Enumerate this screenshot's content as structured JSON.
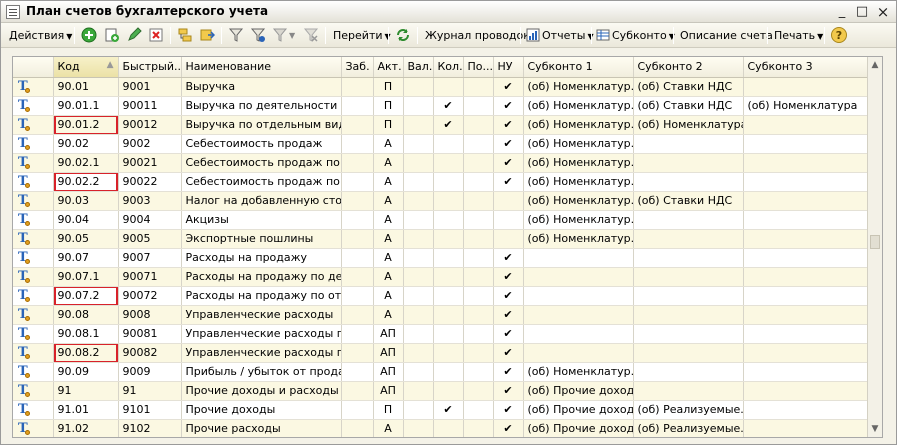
{
  "window": {
    "title": "План счетов бухгалтерского учета",
    "minimize": "_",
    "maximize": "□",
    "close": "×"
  },
  "toolbar": {
    "actions": "Действия",
    "goto": "Перейти",
    "journal": "Журнал проводок",
    "reports": "Отчеты",
    "subkonto": "Субконто",
    "description": "Описание счета",
    "print": "Печать",
    "help": "?"
  },
  "grid": {
    "columns": [
      "",
      "Код",
      "Быстрый...",
      "Наименование",
      "Заб.",
      "Акт.",
      "Вал.",
      "Кол.",
      "По...",
      "НУ",
      "Субконто 1",
      "Субконто 2",
      "Субконто 3"
    ],
    "check": "✔",
    "sort_indicator": "▲",
    "rows": [
      {
        "code": "90.01",
        "quick": "9001",
        "name": "Выручка",
        "zab": "",
        "akt": "П",
        "val": "",
        "kol": "",
        "po": "",
        "nu": "✔",
        "s1": "(об) Номенклатур...",
        "s2": "(об) Ставки НДС",
        "s3": "",
        "highlight": false
      },
      {
        "code": "90.01.1",
        "quick": "90011",
        "name": "Выручка по деятельности с ...",
        "zab": "",
        "akt": "П",
        "val": "",
        "kol": "✔",
        "po": "",
        "nu": "✔",
        "s1": "(об) Номенклатур...",
        "s2": "(об) Ставки НДС",
        "s3": "(об) Номенклатура",
        "highlight": false
      },
      {
        "code": "90.01.2",
        "quick": "90012",
        "name": "Выручка по отдельным вида...",
        "zab": "",
        "akt": "П",
        "val": "",
        "kol": "✔",
        "po": "",
        "nu": "✔",
        "s1": "(об) Номенклатур...",
        "s2": "(об) Номенклатура",
        "s3": "",
        "highlight": true
      },
      {
        "code": "90.02",
        "quick": "9002",
        "name": "Себестоимость продаж",
        "zab": "",
        "akt": "А",
        "val": "",
        "kol": "",
        "po": "",
        "nu": "✔",
        "s1": "(об) Номенклатур...",
        "s2": "",
        "s3": "",
        "highlight": false
      },
      {
        "code": "90.02.1",
        "quick": "90021",
        "name": "Себестоимость продаж по д...",
        "zab": "",
        "akt": "А",
        "val": "",
        "kol": "",
        "po": "",
        "nu": "✔",
        "s1": "(об) Номенклатур...",
        "s2": "",
        "s3": "",
        "highlight": false
      },
      {
        "code": "90.02.2",
        "quick": "90022",
        "name": "Себестоимость продаж по о...",
        "zab": "",
        "akt": "А",
        "val": "",
        "kol": "",
        "po": "",
        "nu": "✔",
        "s1": "(об) Номенклатур...",
        "s2": "",
        "s3": "",
        "highlight": true
      },
      {
        "code": "90.03",
        "quick": "9003",
        "name": "Налог на добавленную стои...",
        "zab": "",
        "akt": "А",
        "val": "",
        "kol": "",
        "po": "",
        "nu": "",
        "s1": "(об) Номенклатур...",
        "s2": "(об) Ставки НДС",
        "s3": "",
        "highlight": false
      },
      {
        "code": "90.04",
        "quick": "9004",
        "name": "Акцизы",
        "zab": "",
        "akt": "А",
        "val": "",
        "kol": "",
        "po": "",
        "nu": "",
        "s1": "(об) Номенклатур...",
        "s2": "",
        "s3": "",
        "highlight": false
      },
      {
        "code": "90.05",
        "quick": "9005",
        "name": "Экспортные пошлины",
        "zab": "",
        "akt": "А",
        "val": "",
        "kol": "",
        "po": "",
        "nu": "",
        "s1": "(об) Номенклатур...",
        "s2": "",
        "s3": "",
        "highlight": false
      },
      {
        "code": "90.07",
        "quick": "9007",
        "name": "Расходы на продажу",
        "zab": "",
        "akt": "А",
        "val": "",
        "kol": "",
        "po": "",
        "nu": "✔",
        "s1": "",
        "s2": "",
        "s3": "",
        "highlight": false
      },
      {
        "code": "90.07.1",
        "quick": "90071",
        "name": "Расходы на продажу по деят...",
        "zab": "",
        "akt": "А",
        "val": "",
        "kol": "",
        "po": "",
        "nu": "✔",
        "s1": "",
        "s2": "",
        "s3": "",
        "highlight": false
      },
      {
        "code": "90.07.2",
        "quick": "90072",
        "name": "Расходы на продажу по отде...",
        "zab": "",
        "akt": "А",
        "val": "",
        "kol": "",
        "po": "",
        "nu": "✔",
        "s1": "",
        "s2": "",
        "s3": "",
        "highlight": true
      },
      {
        "code": "90.08",
        "quick": "9008",
        "name": "Управленческие расходы",
        "zab": "",
        "akt": "А",
        "val": "",
        "kol": "",
        "po": "",
        "nu": "✔",
        "s1": "",
        "s2": "",
        "s3": "",
        "highlight": false
      },
      {
        "code": "90.08.1",
        "quick": "90081",
        "name": "Управленческие расходы по...",
        "zab": "",
        "akt": "АП",
        "val": "",
        "kol": "",
        "po": "",
        "nu": "✔",
        "s1": "",
        "s2": "",
        "s3": "",
        "highlight": false
      },
      {
        "code": "90.08.2",
        "quick": "90082",
        "name": "Управленческие расходы по...",
        "zab": "",
        "akt": "АП",
        "val": "",
        "kol": "",
        "po": "",
        "nu": "✔",
        "s1": "",
        "s2": "",
        "s3": "",
        "highlight": true
      },
      {
        "code": "90.09",
        "quick": "9009",
        "name": "Прибыль / убыток от продаж",
        "zab": "",
        "akt": "АП",
        "val": "",
        "kol": "",
        "po": "",
        "nu": "✔",
        "s1": "(об) Номенклатур...",
        "s2": "",
        "s3": "",
        "highlight": false
      },
      {
        "code": "91",
        "quick": "91",
        "name": "Прочие доходы и расходы",
        "zab": "",
        "akt": "АП",
        "val": "",
        "kol": "",
        "po": "",
        "nu": "✔",
        "s1": "(об) Прочие доход...",
        "s2": "",
        "s3": "",
        "highlight": false
      },
      {
        "code": "91.01",
        "quick": "9101",
        "name": "Прочие доходы",
        "zab": "",
        "akt": "П",
        "val": "",
        "kol": "✔",
        "po": "",
        "nu": "✔",
        "s1": "(об) Прочие доход...",
        "s2": "(об) Реализуемые...",
        "s3": "",
        "highlight": false
      },
      {
        "code": "91.02",
        "quick": "9102",
        "name": "Прочие расходы",
        "zab": "",
        "akt": "А",
        "val": "",
        "kol": "",
        "po": "",
        "nu": "✔",
        "s1": "(об) Прочие доход...",
        "s2": "(об) Реализуемые...",
        "s3": "",
        "highlight": false
      }
    ]
  }
}
